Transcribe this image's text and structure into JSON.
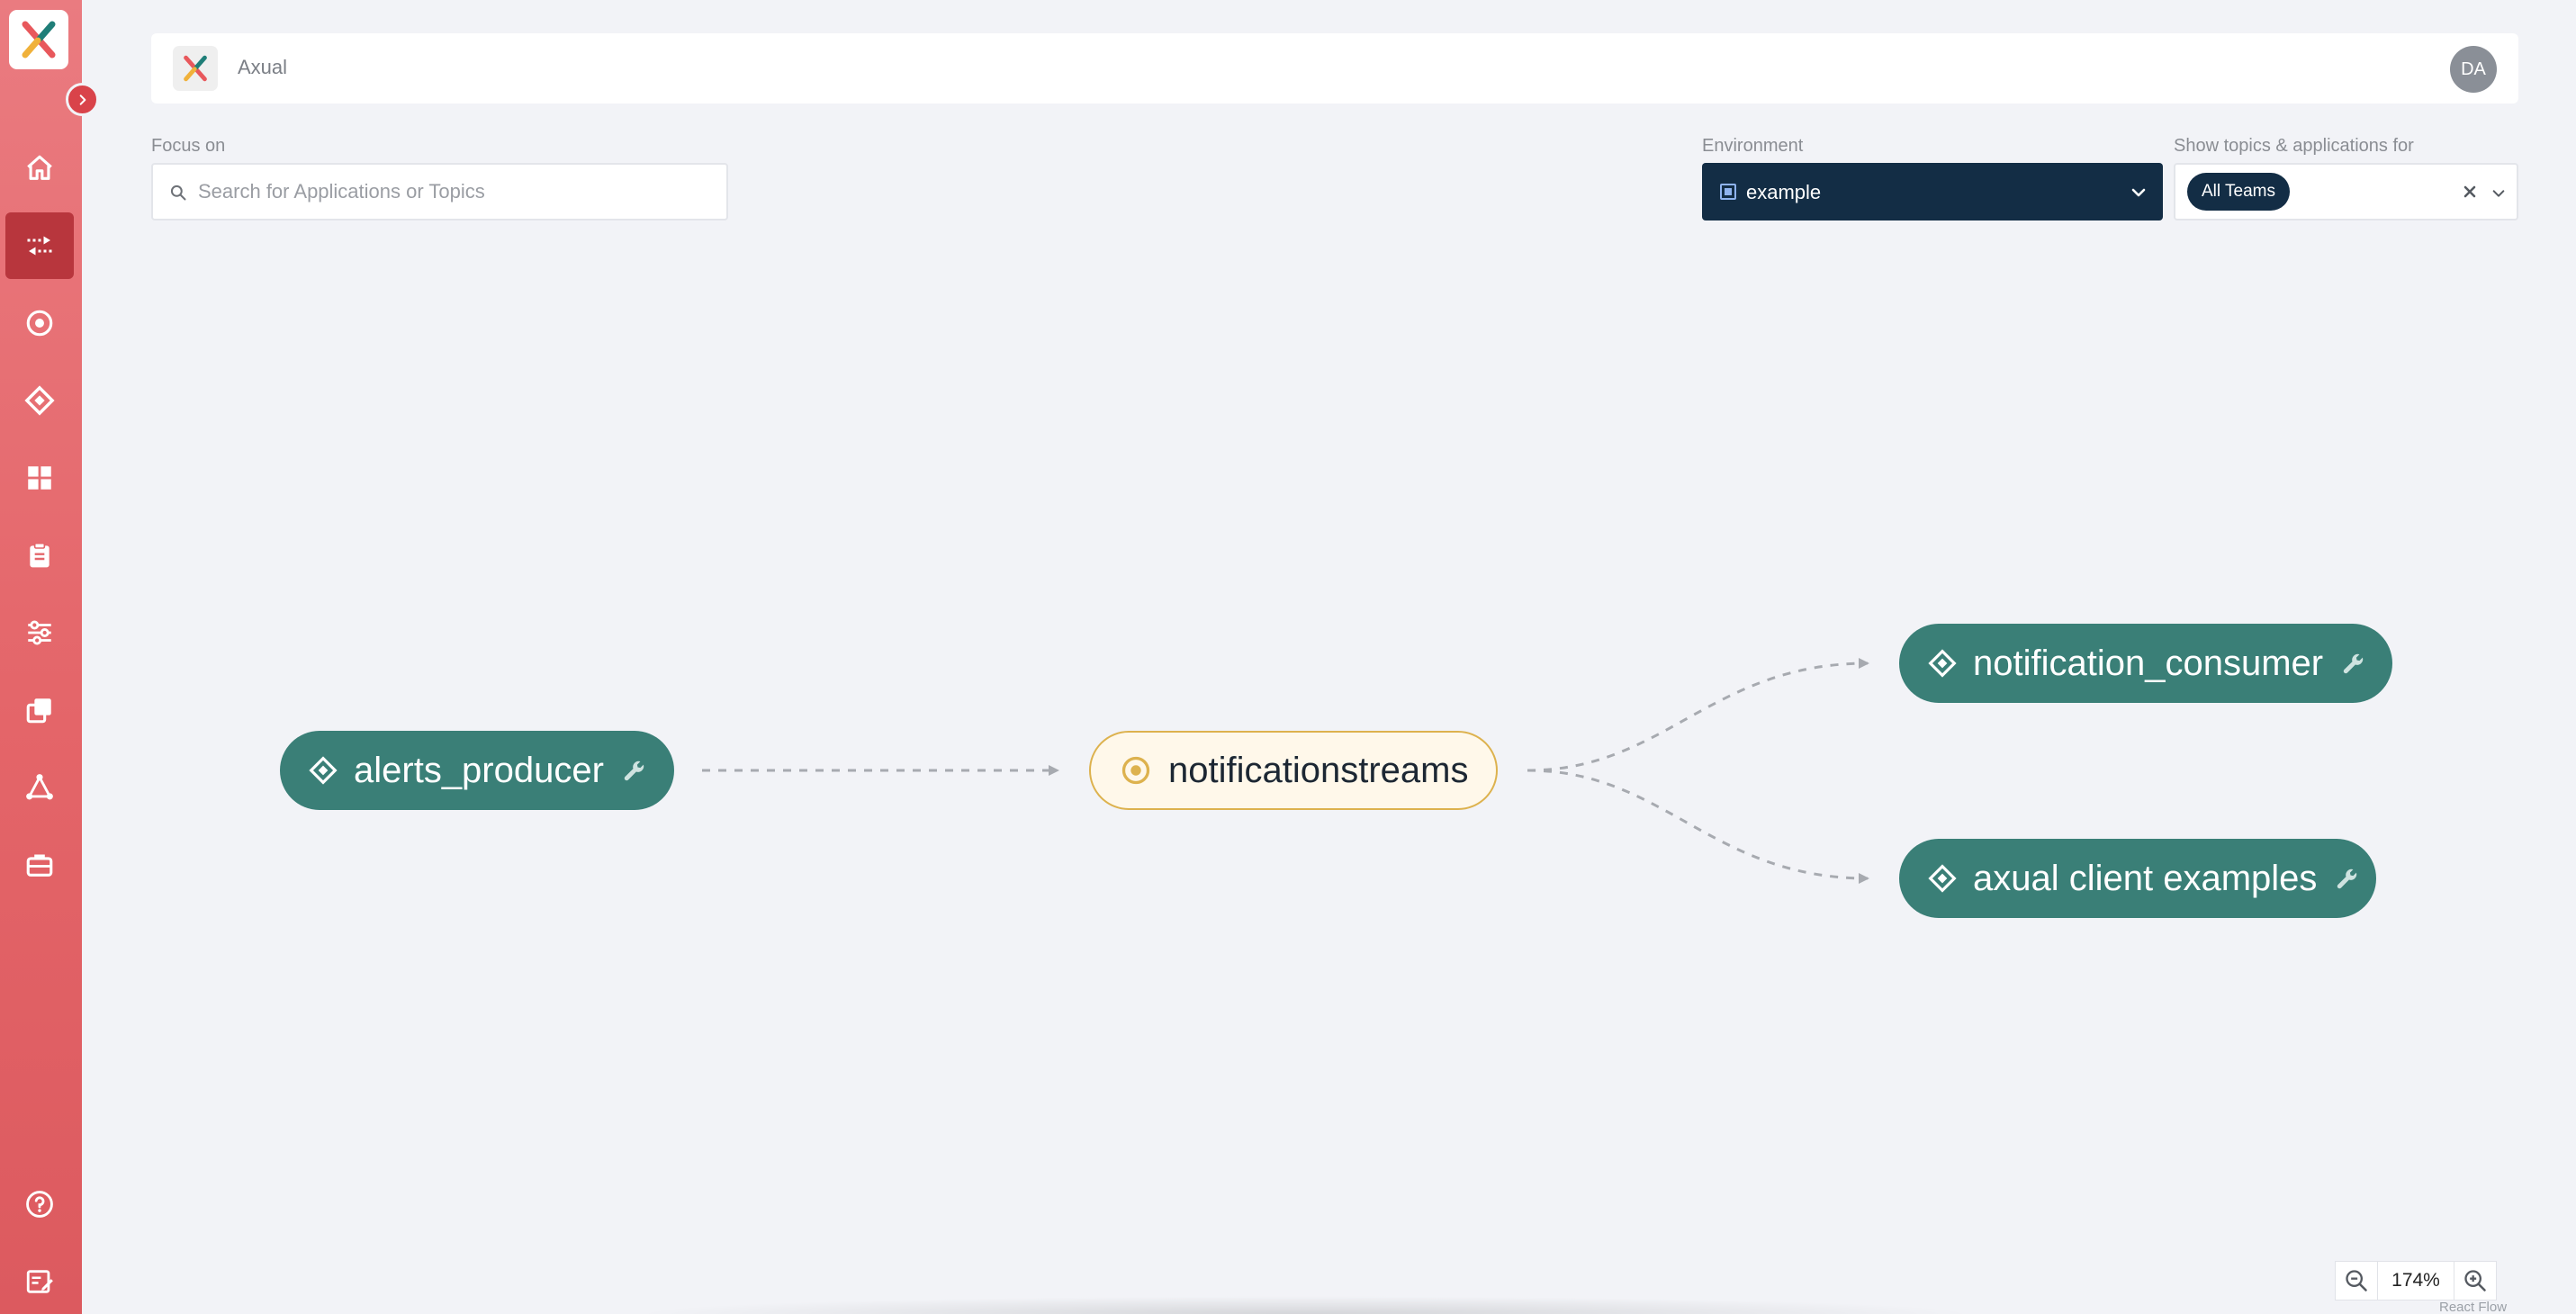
{
  "sidebar": {
    "items": [
      {
        "icon": "home-icon"
      },
      {
        "icon": "data-flow-icon",
        "active": true
      },
      {
        "icon": "topic-icon"
      },
      {
        "icon": "application-icon"
      },
      {
        "icon": "dashboard-icon"
      },
      {
        "icon": "clipboard-icon"
      },
      {
        "icon": "settings-sliders-icon"
      },
      {
        "icon": "copy-icon"
      },
      {
        "icon": "network-icon"
      },
      {
        "icon": "briefcase-icon"
      }
    ],
    "bottom_items": [
      {
        "icon": "help-icon"
      },
      {
        "icon": "feedback-icon"
      }
    ]
  },
  "header": {
    "brand": "Axual",
    "avatar_initials": "DA"
  },
  "controls": {
    "focus_label": "Focus on",
    "search_placeholder": "Search for Applications or Topics",
    "environment_label": "Environment",
    "environment_value": "example",
    "teams_label": "Show topics & applications for",
    "teams_chip": "All Teams"
  },
  "graph": {
    "nodes": [
      {
        "id": "alerts_producer",
        "label": "alerts_producer",
        "kind": "application"
      },
      {
        "id": "notificationstreams",
        "label": "notificationstreams",
        "kind": "topic"
      },
      {
        "id": "notification_consumer",
        "label": "notification_consumer",
        "kind": "application"
      },
      {
        "id": "axual_client_examples",
        "label": "axual client examples",
        "kind": "application"
      }
    ],
    "edges": [
      {
        "from": "alerts_producer",
        "to": "notificationstreams"
      },
      {
        "from": "notificationstreams",
        "to": "notification_consumer"
      },
      {
        "from": "notificationstreams",
        "to": "axual_client_examples"
      }
    ]
  },
  "zoom": {
    "value": "174%",
    "attribution": "React Flow"
  },
  "colors": {
    "sidebar": "#e46569",
    "app_node": "#3a7f77",
    "topic_node_bg": "#fff8ea",
    "topic_node_border": "#ddb24e",
    "navy": "#132d45"
  }
}
